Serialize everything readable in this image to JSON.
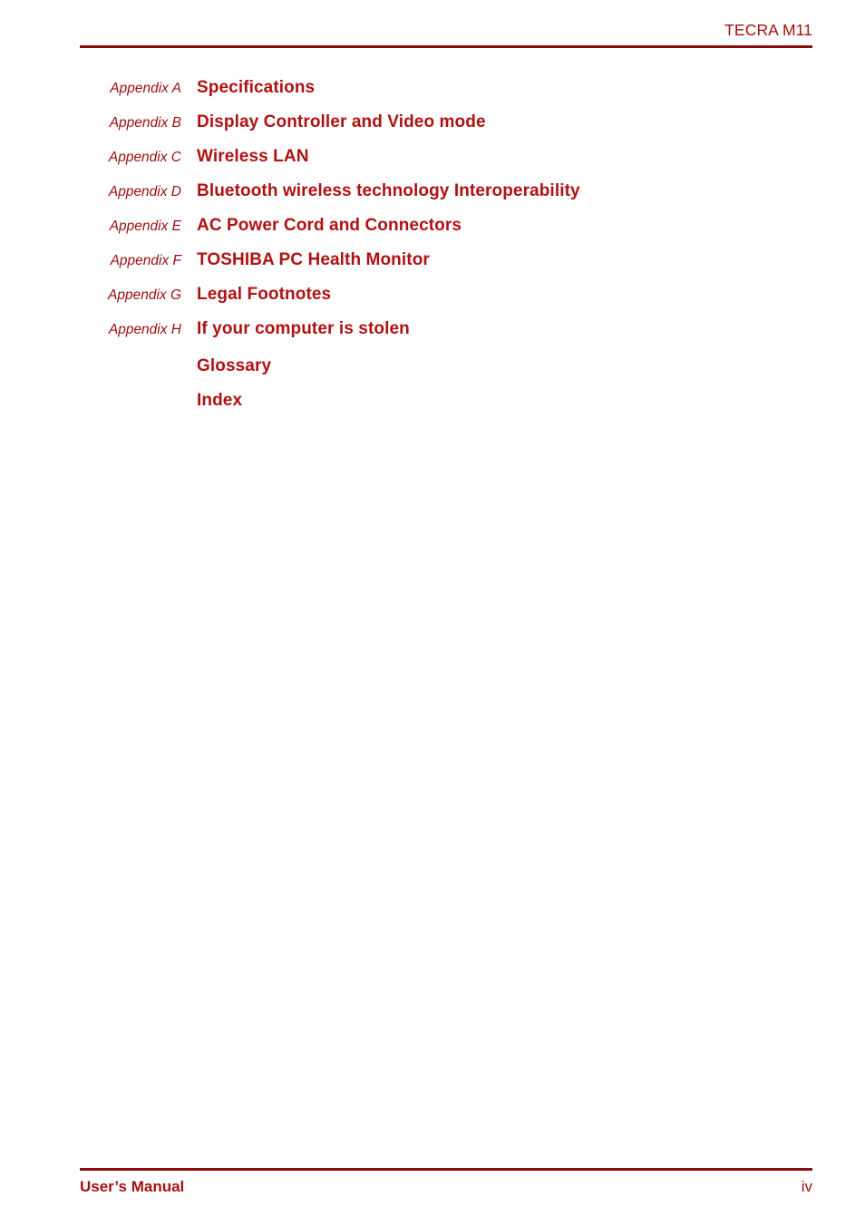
{
  "header": {
    "title": "TECRA M11",
    "rule_color": "#8c0b0b"
  },
  "toc": {
    "entries": [
      {
        "label": "Appendix A",
        "title": "Specifications"
      },
      {
        "label": "Appendix B",
        "title": "Display Controller and Video mode"
      },
      {
        "label": "Appendix C",
        "title": "Wireless LAN"
      },
      {
        "label": "Appendix D",
        "title": "Bluetooth wireless technology Interoperability"
      },
      {
        "label": "Appendix E",
        "title": "AC Power Cord and Connectors"
      },
      {
        "label": "Appendix F",
        "title": "TOSHIBA PC Health Monitor"
      },
      {
        "label": "Appendix G",
        "title": "Legal Footnotes"
      },
      {
        "label": "Appendix H",
        "title": "If your computer is stolen"
      },
      {
        "label": "",
        "title": "Glossary"
      },
      {
        "label": "",
        "title": "Index"
      }
    ],
    "label_color": "#9c0d0d",
    "title_color": "#b01212"
  },
  "footer": {
    "document_name": "User’s Manual",
    "page_number": "iv",
    "rule_color": "#8c0b0b"
  }
}
